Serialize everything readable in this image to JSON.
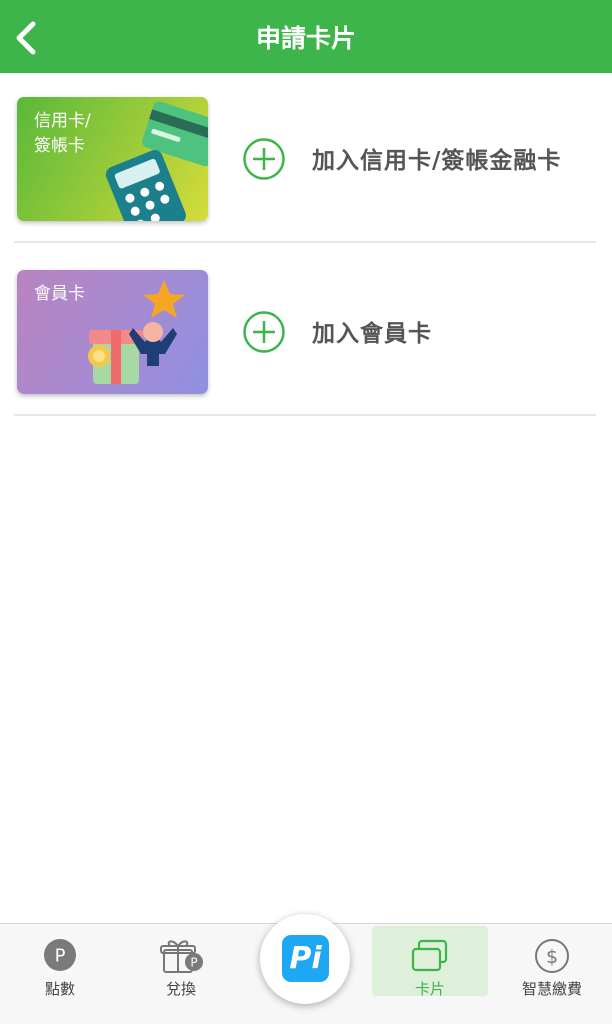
{
  "header": {
    "title": "申請卡片",
    "back_icon": "chevron-left-icon",
    "color": "#3db54a"
  },
  "cards": [
    {
      "thumb_label": "信用卡/\n簽帳卡",
      "action_label": "加入信用卡/簽帳金融卡",
      "action_icon": "plus-circle-icon",
      "art_icons": [
        "credit-card-icon",
        "calculator-icon"
      ]
    },
    {
      "thumb_label": "會員卡",
      "action_label": "加入會員卡",
      "action_icon": "plus-circle-icon",
      "art_icons": [
        "star-icon",
        "person-icon",
        "gift-box-icon",
        "badge-icon"
      ]
    }
  ],
  "tabbar": {
    "tabs": [
      {
        "label": "點數",
        "icon": "points-p-icon"
      },
      {
        "label": "兌換",
        "icon": "gift-exchange-icon"
      },
      {
        "label": "卡片",
        "icon": "cards-icon",
        "active": true
      },
      {
        "label": "智慧繳費",
        "icon": "dollar-circle-icon"
      }
    ],
    "center_button": {
      "label": "Pi",
      "icon": "pi-logo-icon",
      "color": "#1ea7f2"
    }
  }
}
